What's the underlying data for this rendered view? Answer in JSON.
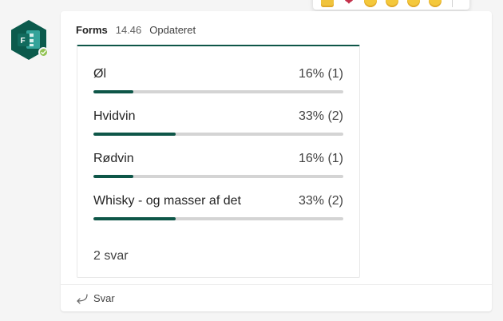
{
  "message": {
    "author": "Forms",
    "time": "14.46",
    "status": "Opdateret"
  },
  "poll": {
    "options": [
      {
        "label": "Øl",
        "result": "16% (1)",
        "fraction": 0.16
      },
      {
        "label": "Hvidvin",
        "result": "33% (2)",
        "fraction": 0.33
      },
      {
        "label": "Rødvin",
        "result": "16% (1)",
        "fraction": 0.16
      },
      {
        "label": "Whisky - og masser af det",
        "result": "33% (2)",
        "fraction": 0.33
      }
    ],
    "answers": "2 svar"
  },
  "reply": {
    "label": "Svar"
  },
  "reactions": [
    "like-icon",
    "heart-icon",
    "laugh-icon",
    "surprised-icon",
    "sad-icon",
    "angry-icon"
  ],
  "colors": {
    "accent": "#0e5648",
    "presence": "#92c353",
    "heart": "#c4314b"
  }
}
